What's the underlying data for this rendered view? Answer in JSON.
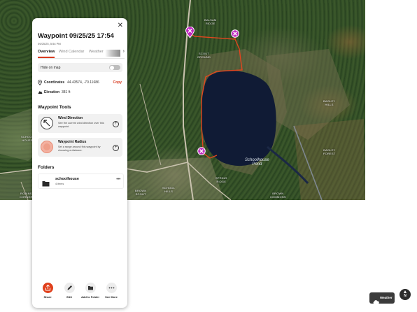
{
  "map": {
    "labels": [
      {
        "text": "BALSAM\nRIDGE"
      },
      {
        "text": "SCOUT\nGROUND"
      },
      {
        "text": "BAGLEY\nHILLS"
      },
      {
        "text": "SCHOOL\nHOUSE"
      },
      {
        "text": "BAGLEY\nFOREST"
      },
      {
        "text": "ROBINS\nCORNER"
      },
      {
        "text": "SPRING\nRIDGE"
      },
      {
        "text": "BROWN\nSCOUT"
      },
      {
        "text": "BROWN\nCOMMONS"
      },
      {
        "text": "SCHOOL\nHILLS"
      }
    ],
    "pond_label": "Schoolhouse\nPond",
    "route_color": "#e2461f",
    "pin_color": "#c02bc0"
  },
  "panel": {
    "title": "Waypoint 09/25/25 17:54",
    "subtitle": "09/25/25, 5:54 PM",
    "tabs": [
      "Overview",
      "Wind Calendar",
      "Weather"
    ],
    "active_tab": "Overview",
    "hide_on_map": {
      "label": "Hide on map",
      "enabled": false
    },
    "coordinates": {
      "label": "Coordinates",
      "value": "44.43574, -70.11686",
      "copy_label": "Copy"
    },
    "elevation": {
      "label": "Elevation",
      "value": "381 ft"
    },
    "tools_heading": "Waypoint Tools",
    "tools": [
      {
        "title": "Wind Direction",
        "desc": "See the current wind direction over this waypoint."
      },
      {
        "title": "Waypoint Radius",
        "desc": "Set a range around this waypoint by choosing a distance."
      }
    ],
    "folders_heading": "Folders",
    "folder": {
      "name": "schoolhouse",
      "count": "4 items"
    },
    "actions": [
      "Share",
      "Edit",
      "Add to Folder",
      "See More"
    ]
  },
  "controls": {
    "weather_label": "Weather",
    "compass_label": "N"
  },
  "colors": {
    "accent": "#d83a1f"
  }
}
